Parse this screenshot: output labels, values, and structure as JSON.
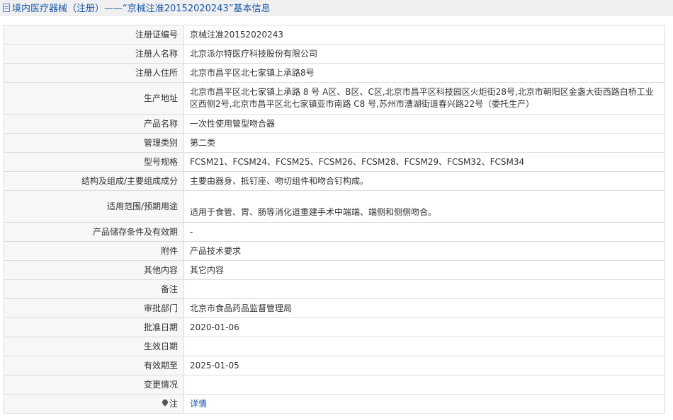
{
  "header": {
    "title": "境内医疗器械（注册）——“京械注准20152020243”基本信息"
  },
  "rows": [
    {
      "label": "注册证编号",
      "value": "京械注准20152020243"
    },
    {
      "label": "注册人名称",
      "value": "北京派尔特医疗科技股份有限公司"
    },
    {
      "label": "注册人住所",
      "value": "北京市昌平区北七家镇上承路8号"
    },
    {
      "label": "生产地址",
      "value": "北京市昌平区北七家镇上承路 8 号 A区、B区、C区,北京市昌平区科技园区火炬街28号,北京市朝阳区金盏大街西路白桥工业区西侧2号,北京市昌平区北七家镇亚市南路 C8 号,苏州市漕湖街道春兴路22号（委托生产）"
    },
    {
      "label": "产品名称",
      "value": "一次性使用管型吻合器"
    },
    {
      "label": "管理类别",
      "value": "第二类"
    },
    {
      "label": "型号规格",
      "value": "FCSM21、FCSM24、FCSM25、FCSM26、FCSM28、FCSM29、FCSM32、FCSM34"
    },
    {
      "label": "结构及组成/主要组成成分",
      "value": "主要由器身、抵钉座、吻切组件和吻合钉构成。"
    },
    {
      "label": "适用范围/预期用途",
      "value": "适用于食管、胃、肠等消化道重建手术中端端、端侧和侧侧吻合。"
    },
    {
      "label": "产品储存条件及有效期",
      "value": "-"
    },
    {
      "label": "附件",
      "value": "产品技术要求"
    },
    {
      "label": "其他内容",
      "value": "其它内容"
    },
    {
      "label": "备注",
      "value": ""
    },
    {
      "label": "审批部门",
      "value": "北京市食品药品监督管理局"
    },
    {
      "label": "批准日期",
      "value": "2020-01-06"
    },
    {
      "label": "生效日期",
      "value": ""
    },
    {
      "label": "有效期至",
      "value": "2025-01-05"
    },
    {
      "label": "变更情况",
      "value": ""
    }
  ],
  "note_row": {
    "label": "注",
    "link_text": "详情",
    "icon": "pin-icon"
  },
  "colors": {
    "header_text": "#1a57a8",
    "link": "#1a57a8",
    "label_bg": "#f7f7f7",
    "border": "#dcdcdc"
  }
}
